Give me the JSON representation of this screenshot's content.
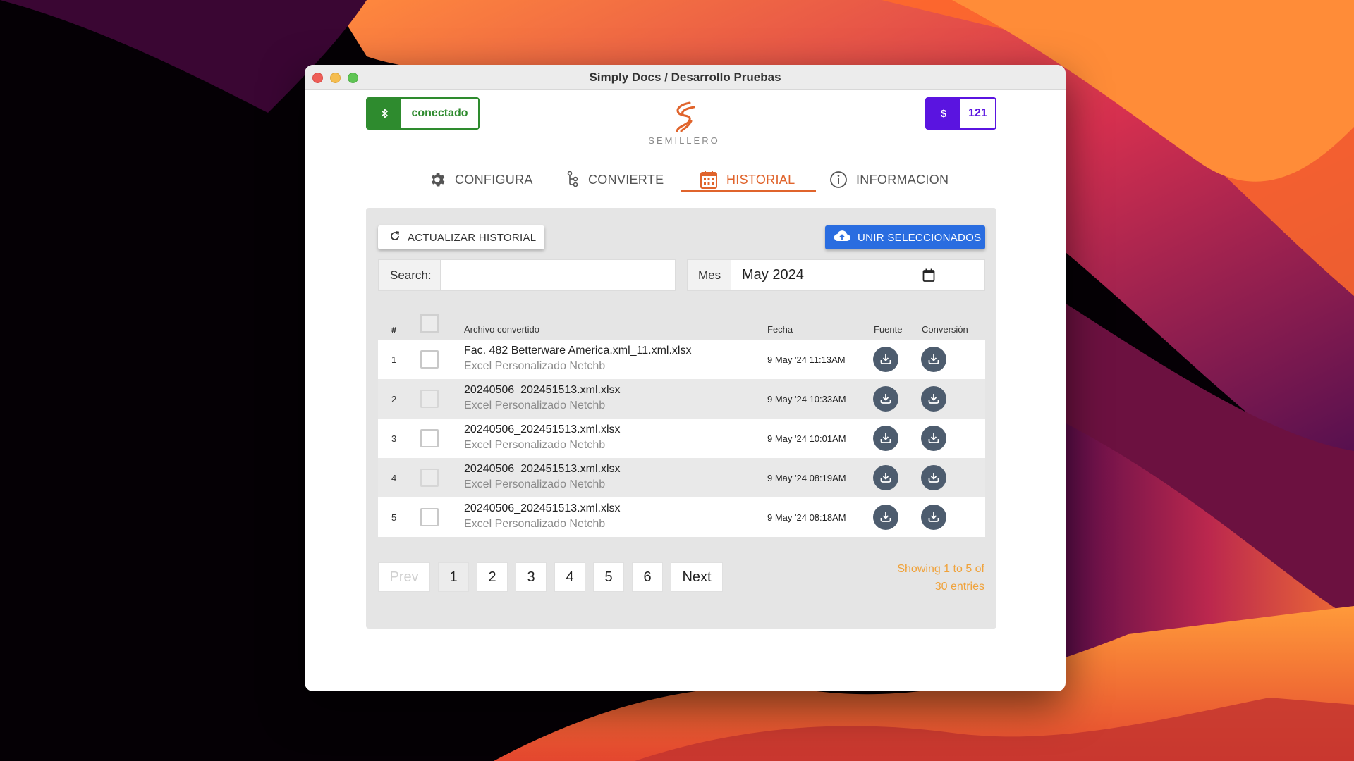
{
  "window": {
    "title": "Simply Docs / Desarrollo Pruebas"
  },
  "connection": {
    "label": "conectado",
    "icon": "bluetooth-icon"
  },
  "credits": {
    "symbol": "$",
    "value": "121"
  },
  "logo": {
    "text": "SEMILLERO"
  },
  "tabs": [
    {
      "label": "CONFIGURA",
      "icon": "gear-icon",
      "active": false
    },
    {
      "label": "CONVIERTE",
      "icon": "branch-icon",
      "active": false
    },
    {
      "label": "HISTORIAL",
      "icon": "calendar-icon",
      "active": true
    },
    {
      "label": "INFORMACION",
      "icon": "info-icon",
      "active": false
    }
  ],
  "toolbar": {
    "refresh_label": "ACTUALIZAR HISTORIAL",
    "merge_label": "UNIR SELECCIONADOS"
  },
  "filters": {
    "search_label": "Search:",
    "search_value": "",
    "month_label": "Mes",
    "month_value": "May 2024"
  },
  "table": {
    "headers": {
      "num": "#",
      "file": "Archivo convertido",
      "date": "Fecha",
      "source": "Fuente",
      "conversion": "Conversión"
    },
    "rows": [
      {
        "num": "1",
        "name": "Fac. 482 Betterware America.xml_11.xml.xlsx",
        "type": "Excel Personalizado Netchb",
        "date": "9 May '24 11:13AM"
      },
      {
        "num": "2",
        "name": "20240506_202451513.xml.xlsx",
        "type": "Excel Personalizado Netchb",
        "date": "9 May '24 10:33AM"
      },
      {
        "num": "3",
        "name": "20240506_202451513.xml.xlsx",
        "type": "Excel Personalizado Netchb",
        "date": "9 May '24 10:01AM"
      },
      {
        "num": "4",
        "name": "20240506_202451513.xml.xlsx",
        "type": "Excel Personalizado Netchb",
        "date": "9 May '24 08:19AM"
      },
      {
        "num": "5",
        "name": "20240506_202451513.xml.xlsx",
        "type": "Excel Personalizado Netchb",
        "date": "9 May '24 08:18AM"
      }
    ]
  },
  "pagination": {
    "prev": "Prev",
    "pages": [
      "1",
      "2",
      "3",
      "4",
      "5",
      "6"
    ],
    "current": "1",
    "next": "Next",
    "entries_line1": "Showing 1 to 5 of",
    "entries_line2": "30 entries"
  },
  "colors": {
    "accent": "#e0642c",
    "connected": "#2e8b2e",
    "credits": "#5a14e0",
    "merge": "#2a6de0",
    "entries": "#f0a23a"
  }
}
